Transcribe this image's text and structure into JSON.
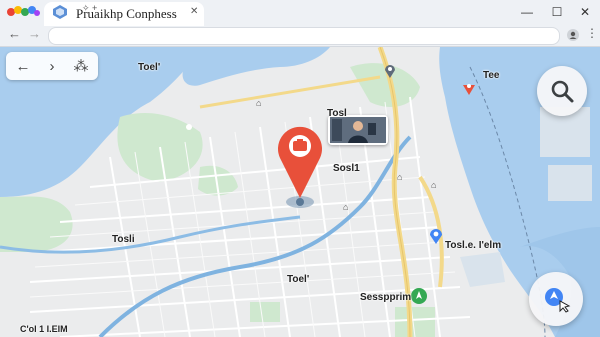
{
  "browser": {
    "tab_title": "Pruaikhp Conphess",
    "tab_icons": "✧ +",
    "window_controls": {
      "minimize": "—",
      "maximize": "☐",
      "close": "✕"
    }
  },
  "map_controls": {
    "back": "←",
    "forward": "›",
    "share": "⁂"
  },
  "labels": {
    "top_left": "Toel'",
    "top_right": "Tee",
    "center_top": "Tosl",
    "center_mid": "Sosl1",
    "left_mid": "Tosli",
    "right_mid": "Tosl.e. I'elm",
    "bottom_center": "Toel'",
    "bottom_poi": "Sesspprim",
    "bottom_left": "C'ol 1 I.ElM"
  },
  "colors": {
    "water": "#a9cdee",
    "land": "#ececec",
    "park": "#c8e6c9",
    "highway": "#f3d98a",
    "river": "#7fb3e0",
    "pin": "#e8503a",
    "poi_green": "#34a853",
    "poi_blue": "#4285f4"
  }
}
